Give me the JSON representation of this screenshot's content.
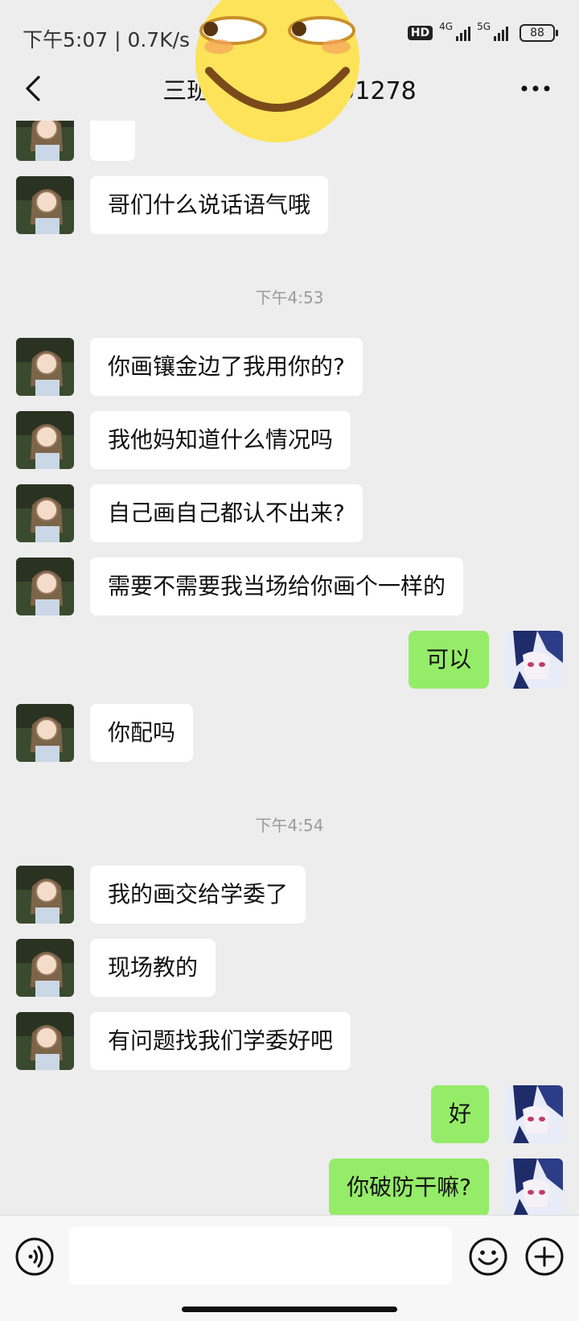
{
  "status_bar": {
    "time": "下午5:07 | 0.7K/s",
    "hd": "HD",
    "net1": "4G",
    "net2": "5G",
    "battery": "88"
  },
  "header": {
    "title_left": "三班",
    "title_right": "51278",
    "back_icon": "chevron-left-icon",
    "more_icon": "more-dots-icon"
  },
  "messages": [
    {
      "side": "left",
      "text": ""
    },
    {
      "side": "left",
      "text": "哥们什么说话语气哦"
    },
    {
      "timestamp": "下午4:53"
    },
    {
      "side": "left",
      "text": "你画镶金边了我用你的?"
    },
    {
      "side": "left",
      "text": "我他妈知道什么情况吗"
    },
    {
      "side": "left",
      "text": "自己画自己都认不出来?"
    },
    {
      "side": "left",
      "text": "需要不需要我当场给你画个一样的"
    },
    {
      "side": "right",
      "text": "可以"
    },
    {
      "side": "left",
      "text": "你配吗"
    },
    {
      "timestamp": "下午4:54"
    },
    {
      "side": "left",
      "text": "我的画交给学委了"
    },
    {
      "side": "left",
      "text": "现场教的"
    },
    {
      "side": "left",
      "text": "有问题找我们学委好吧"
    },
    {
      "side": "right",
      "text": "好"
    },
    {
      "side": "right",
      "text": "你破防干嘛?"
    }
  ],
  "input_bar": {
    "placeholder": "",
    "voice_icon": "voice-icon",
    "emoji_icon": "emoji-icon",
    "plus_icon": "plus-icon"
  },
  "colors": {
    "background": "#EDEDED",
    "bubble_left": "#FFFFFF",
    "bubble_right": "#95EC69",
    "timestamp": "#9B9B9B"
  }
}
